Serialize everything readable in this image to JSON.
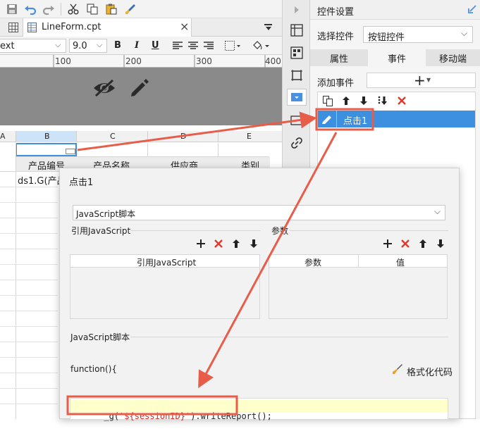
{
  "toolbar": {
    "icons": [
      "save-icon",
      "undo-icon",
      "redo-icon",
      "cut-icon",
      "copy-icon",
      "paste-icon",
      "format-brush-icon"
    ]
  },
  "tab": {
    "file_name": "LineForm.cpt",
    "close": "×"
  },
  "format_bar": {
    "font": "ext",
    "size": "9.0",
    "bold": "B",
    "italic": "I",
    "underline": "U"
  },
  "ruler": {
    "ticks": [
      "100",
      "200",
      "300",
      "400"
    ]
  },
  "sheet": {
    "columns": [
      "A",
      "B",
      "C",
      "D",
      "E"
    ],
    "headers": [
      "产品编号",
      "产品名称",
      "供应商",
      "类别"
    ],
    "cell_b3": "ds1.G(产品"
  },
  "right_panel": {
    "title": "控件设置",
    "select_label": "选择控件",
    "select_value": "按钮控件",
    "tabs": [
      "属性",
      "事件",
      "移动端"
    ],
    "add_event_label": "添加事件",
    "add_event_button": "+",
    "event_item": "点击1"
  },
  "dialog": {
    "title": "点击1",
    "type_select": "JavaScript脚本",
    "ref_js_label": "引用JavaScript",
    "params_label": "参数",
    "ref_js_col": "引用JavaScript",
    "param_col": "参数",
    "value_col": "值",
    "script_label": "JavaScript脚本",
    "function_text": "function(){",
    "format_code": "格式化代码",
    "code": {
      "prefix": "_g(",
      "string": "'${sessionID}'",
      "suffix": ").writeReport();"
    }
  },
  "colors": {
    "accent": "#4a90e2",
    "highlight": "#e85d4a",
    "selected_row": "#3d8fe0",
    "code_bg": "#ffffcc",
    "code_string": "#c8302a"
  }
}
